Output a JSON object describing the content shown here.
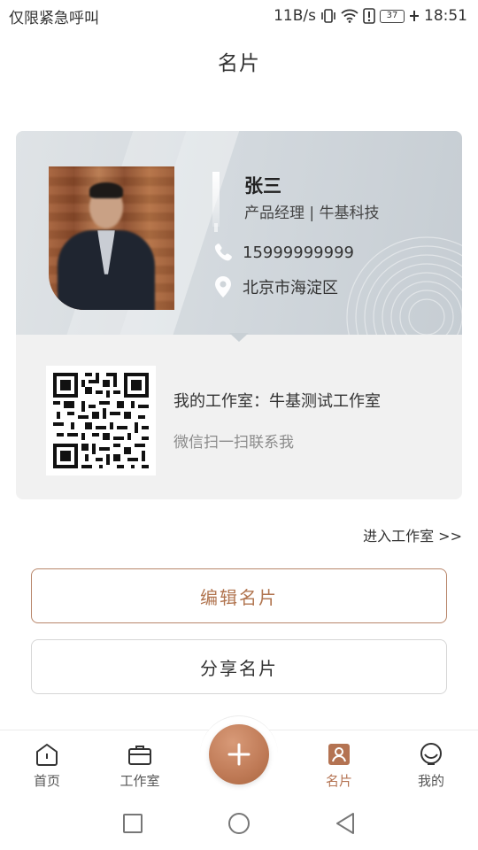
{
  "status_bar": {
    "left_text": "仅限紧急呼叫",
    "speed": "11B/s",
    "battery": "37",
    "time": "18:51"
  },
  "header": {
    "title": "名片"
  },
  "card": {
    "name": "张三",
    "job": "产品经理 | 牛基科技",
    "phone": "15999999999",
    "address": "北京市海淀区",
    "studio": "我的工作室：牛基测试工作室",
    "scan_hint": "微信扫一扫联系我"
  },
  "links": {
    "enter_studio": "进入工作室 >>"
  },
  "buttons": {
    "edit": "编辑名片",
    "share": "分享名片"
  },
  "tab_bar": {
    "items": [
      {
        "label": "首页",
        "icon": "home-icon"
      },
      {
        "label": "工作室",
        "icon": "briefcase-icon"
      },
      {
        "label": "名片",
        "icon": "card-icon",
        "active": true
      },
      {
        "label": "我的",
        "icon": "profile-icon"
      }
    ],
    "fab_icon": "plus-icon"
  },
  "colors": {
    "accent": "#b47352",
    "card_top": "#d2d8dd",
    "card_bottom": "#f1f1f1"
  }
}
